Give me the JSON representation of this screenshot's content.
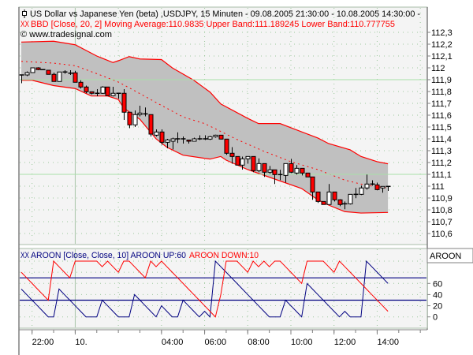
{
  "header": {
    "title": "US Dollar vs Japanese Yen (beta) ,USDJPY, 15 Minuten - 09.08.2005 21:30:00 - 10.08.2005 14:30:00 -",
    "indicator_icon": "XX",
    "indicator": "BBD [Close, 20, 2] Moving Average:110.9835 Upper Band:111.189245 Lower Band:110.777755",
    "copyright": "© www.tradesignal.com"
  },
  "aroon_header": {
    "icon": "XX",
    "label": "AROON [Close, Close, 10] AROON UP:60",
    "down_label": "AROON DOWN:10",
    "panel_label": "AROON"
  },
  "colors": {
    "up_candle": "#ffffff",
    "down_candle": "#ff0000",
    "band_fill": "#c0c0c0",
    "band_line": "#ff0000",
    "aroon_up": "#000080",
    "aroon_down": "#ff0000",
    "panel_bg": "#f4f4f4",
    "level_line": "#a8e0a8"
  },
  "chart_data": [
    {
      "type": "candlestick",
      "symbol": "USDJPY",
      "interval_minutes": 15,
      "start": "09.08.2005 21:30",
      "end": "10.08.2005 14:30",
      "ylim": [
        110.6,
        112.3
      ],
      "y_tick_labels": [
        "112,3",
        "112,2",
        "112,1",
        "112",
        "111,9",
        "111,8",
        "111,7",
        "111,6",
        "111,5",
        "111,4",
        "111,3",
        "111,2",
        "111,1",
        "111",
        "110,9",
        "110,8",
        "110,7",
        "110,6"
      ],
      "grid": true,
      "horizontal_levels": [
        111.9,
        111.1
      ],
      "ohlc": [
        [
          111.94,
          111.94,
          111.87,
          111.94
        ],
        [
          111.94,
          111.97,
          111.93,
          111.96
        ],
        [
          111.96,
          112.0,
          111.96,
          112.0
        ],
        [
          112.0,
          112.005,
          111.98,
          111.985
        ],
        [
          111.985,
          111.99,
          111.98,
          111.985
        ],
        [
          111.98,
          111.98,
          111.945,
          111.945
        ],
        [
          111.945,
          111.96,
          111.885,
          111.885
        ],
        [
          111.885,
          111.965,
          111.885,
          111.965
        ],
        [
          111.965,
          111.98,
          111.95,
          111.965
        ],
        [
          111.955,
          111.98,
          111.94,
          111.955
        ],
        [
          111.958,
          111.975,
          111.878,
          111.878
        ],
        [
          111.878,
          111.895,
          111.825,
          111.838
        ],
        [
          111.838,
          111.85,
          111.785,
          111.798
        ],
        [
          111.798,
          111.8,
          111.775,
          111.785
        ],
        [
          111.785,
          111.82,
          111.76,
          111.785
        ],
        [
          111.785,
          111.845,
          111.78,
          111.838
        ],
        [
          111.838,
          111.838,
          111.765,
          111.765
        ],
        [
          111.765,
          111.84,
          111.758,
          111.785
        ],
        [
          111.785,
          111.785,
          111.74,
          111.785
        ],
        [
          111.785,
          111.82,
          111.56,
          111.625
        ],
        [
          111.625,
          111.625,
          111.49,
          111.518
        ],
        [
          111.518,
          111.64,
          111.5,
          111.605
        ],
        [
          111.605,
          111.68,
          111.59,
          111.618
        ],
        [
          111.611,
          111.665,
          111.59,
          111.611
        ],
        [
          111.605,
          111.605,
          111.42,
          111.44
        ],
        [
          111.431,
          111.48,
          111.42,
          111.458
        ],
        [
          111.458,
          111.48,
          111.35,
          111.371
        ],
        [
          111.371,
          111.4,
          111.32,
          111.391
        ],
        [
          111.38,
          111.41,
          111.31,
          111.4
        ],
        [
          111.4,
          111.455,
          111.365,
          111.4
        ],
        [
          111.4,
          111.42,
          111.36,
          111.4
        ],
        [
          111.39,
          111.39,
          111.36,
          111.38
        ],
        [
          111.38,
          111.41,
          111.38,
          111.4
        ],
        [
          111.4,
          111.43,
          111.39,
          111.4
        ],
        [
          111.4,
          111.43,
          111.39,
          111.4
        ],
        [
          111.398,
          111.425,
          111.39,
          111.418
        ],
        [
          111.418,
          111.435,
          111.41,
          111.431
        ],
        [
          111.431,
          111.431,
          111.395,
          111.398
        ],
        [
          111.398,
          111.398,
          111.265,
          111.278
        ],
        [
          111.278,
          111.33,
          111.19,
          111.251
        ],
        [
          111.251,
          111.251,
          111.178,
          111.178
        ],
        [
          111.178,
          111.25,
          111.14,
          111.231
        ],
        [
          111.231,
          111.251,
          111.19,
          111.251
        ],
        [
          111.251,
          111.251,
          111.118,
          111.131
        ],
        [
          111.131,
          111.235,
          111.118,
          111.191
        ],
        [
          111.191,
          111.191,
          111.078,
          111.118
        ],
        [
          111.118,
          111.171,
          111.105,
          111.138
        ],
        [
          111.138,
          111.138,
          111.018,
          111.098
        ],
        [
          111.098,
          111.138,
          111.051,
          111.098
        ],
        [
          111.091,
          111.191,
          111.031,
          111.191
        ],
        [
          111.191,
          111.231,
          111.111,
          111.118
        ],
        [
          111.111,
          111.178,
          111.098,
          111.151
        ],
        [
          111.151,
          111.151,
          111.091,
          111.111
        ],
        [
          111.111,
          111.111,
          111.078,
          111.078
        ],
        [
          111.078,
          111.078,
          110.885,
          110.951
        ],
        [
          110.951,
          110.951,
          110.858,
          110.871
        ],
        [
          110.871,
          110.871,
          110.845,
          110.845
        ],
        [
          110.845,
          111.018,
          110.845,
          110.951
        ],
        [
          110.951,
          110.951,
          110.871,
          110.885
        ],
        [
          110.885,
          110.89,
          110.831,
          110.845
        ],
        [
          110.851,
          110.871,
          110.805,
          110.851
        ],
        [
          110.851,
          110.931,
          110.845,
          110.931
        ],
        [
          110.931,
          110.985,
          110.898,
          110.931
        ],
        [
          110.931,
          111.005,
          110.925,
          110.985
        ],
        [
          110.985,
          111.098,
          110.971,
          111.018
        ],
        [
          111.018,
          111.05,
          111.005,
          111.018
        ],
        [
          111.011,
          111.03,
          110.965,
          110.971
        ],
        [
          110.985,
          110.998,
          110.945,
          110.998
        ],
        [
          110.998,
          110.998,
          110.96,
          110.998
        ]
      ],
      "bollinger": {
        "params": "Close, 20, 2",
        "upper": [
          [
            "21:30",
            112.218
          ],
          [
            "23:00",
            112.225
          ],
          [
            "00:00",
            112.195
          ],
          [
            "01:00",
            112.1
          ],
          [
            "01:45",
            112.045
          ],
          [
            "02:00",
            112.06
          ],
          [
            "02:30",
            112.095
          ],
          [
            "03:00",
            112.075
          ],
          [
            "04:00",
            112.07
          ],
          [
            "04:30",
            112.0
          ],
          [
            "05:30",
            111.895
          ],
          [
            "06:15",
            111.795
          ],
          [
            "06:45",
            111.695
          ],
          [
            "08:00",
            111.573
          ],
          [
            "08:30",
            111.529
          ],
          [
            "09:30",
            111.529
          ],
          [
            "11:15",
            111.407
          ],
          [
            "11:45",
            111.36
          ],
          [
            "12:45",
            111.307
          ],
          [
            "13:15",
            111.251
          ],
          [
            "14:00",
            111.207
          ],
          [
            "14:30",
            111.189
          ]
        ],
        "middle": [
          [
            "21:30",
            112.055
          ],
          [
            "23:00",
            112.04
          ],
          [
            "00:00",
            112.018
          ],
          [
            "01:00",
            111.951
          ],
          [
            "02:00",
            111.88
          ],
          [
            "02:45",
            111.807
          ],
          [
            "03:45",
            111.707
          ],
          [
            "05:00",
            111.585
          ],
          [
            "06:00",
            111.529
          ],
          [
            "06:45",
            111.462
          ],
          [
            "07:30",
            111.395
          ],
          [
            "08:45",
            111.295
          ],
          [
            "10:00",
            111.207
          ],
          [
            "11:15",
            111.14
          ],
          [
            "12:30",
            111.051
          ],
          [
            "13:30",
            111.007
          ],
          [
            "14:30",
            110.984
          ]
        ],
        "lower": [
          [
            "21:30",
            111.895
          ],
          [
            "22:00",
            111.895
          ],
          [
            "23:00",
            111.85
          ],
          [
            "00:00",
            111.825
          ],
          [
            "00:45",
            111.762
          ],
          [
            "01:30",
            111.762
          ],
          [
            "02:00",
            111.733
          ],
          [
            "02:15",
            111.66
          ],
          [
            "03:00",
            111.565
          ],
          [
            "03:45",
            111.4
          ],
          [
            "04:15",
            111.329
          ],
          [
            "05:00",
            111.262
          ],
          [
            "06:15",
            111.229
          ],
          [
            "06:45",
            111.251
          ],
          [
            "07:00",
            111.22
          ],
          [
            "08:00",
            111.14
          ],
          [
            "09:15",
            111.06
          ],
          [
            "10:30",
            110.98
          ],
          [
            "11:15",
            110.885
          ],
          [
            "11:45",
            110.84
          ],
          [
            "12:30",
            110.785
          ],
          [
            "13:15",
            110.773
          ],
          [
            "14:30",
            110.778
          ]
        ]
      }
    },
    {
      "type": "line",
      "indicator": "AROON",
      "ylim": [
        0,
        100
      ],
      "y_tick_labels": [
        "60",
        "40",
        "20",
        "0"
      ],
      "levels": [
        70,
        30
      ],
      "series": [
        {
          "name": "AROON UP",
          "values": [
            50,
            40,
            30,
            20,
            10,
            0,
            0,
            50,
            40,
            30,
            20,
            10,
            0,
            0,
            0,
            30,
            20,
            10,
            0,
            0,
            0,
            40,
            30,
            20,
            10,
            0,
            20,
            10,
            0,
            0,
            30,
            20,
            10,
            0,
            10,
            0,
            100,
            90,
            80,
            70,
            60,
            50,
            40,
            30,
            20,
            10,
            0,
            0,
            0,
            30,
            20,
            10,
            0,
            60,
            50,
            40,
            30,
            20,
            10,
            0,
            10,
            0,
            0,
            0,
            100,
            90,
            80,
            70,
            60
          ]
        },
        {
          "name": "AROON DOWN",
          "values": [
            80,
            70,
            60,
            50,
            40,
            30,
            100,
            90,
            80,
            70,
            100,
            100,
            100,
            100,
            100,
            90,
            100,
            90,
            80,
            100,
            100,
            90,
            80,
            70,
            100,
            90,
            100,
            90,
            80,
            70,
            60,
            50,
            40,
            30,
            20,
            10,
            0,
            40,
            100,
            100,
            100,
            90,
            80,
            100,
            90,
            100,
            90,
            100,
            100,
            90,
            80,
            70,
            60,
            100,
            100,
            100,
            100,
            90,
            80,
            100,
            90,
            80,
            70,
            60,
            50,
            40,
            30,
            20,
            10
          ]
        }
      ]
    }
  ],
  "x_axis": {
    "ticks": [
      {
        "label": "22:00",
        "time": "22:00"
      },
      {
        "label": "10.",
        "time": "00:00"
      },
      {
        "label": "04:00",
        "time": "04:00"
      },
      {
        "label": "06:00",
        "time": "06:00"
      },
      {
        "label": "08:00",
        "time": "08:00"
      },
      {
        "label": "10:00",
        "time": "10:00"
      },
      {
        "label": "12:00",
        "time": "12:00"
      },
      {
        "label": "14:00",
        "time": "14:00"
      }
    ]
  }
}
